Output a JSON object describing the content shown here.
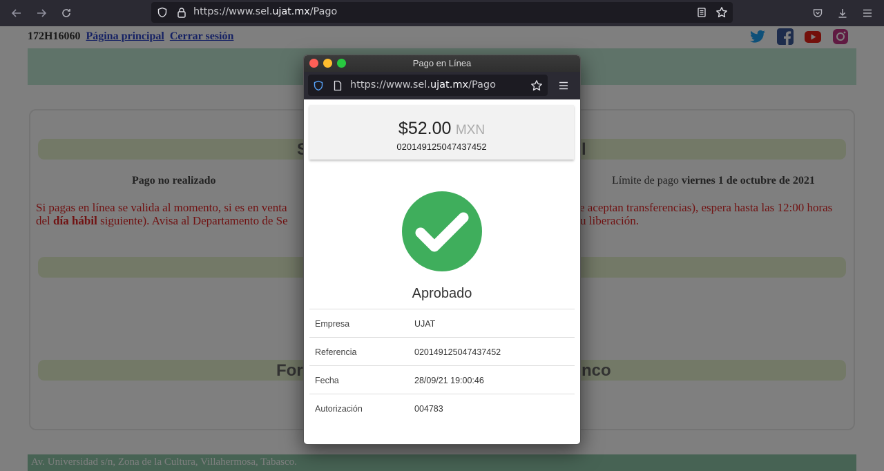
{
  "browser": {
    "url_prefix": "https://www.sel.",
    "url_domain": "ujat.mx",
    "url_path": "/Pago"
  },
  "page": {
    "user_id": "172H16060",
    "home_link": "Página principal",
    "logout_link": "Cerrar sesión",
    "status_left": "Pago no realizado",
    "limit_label": "Límite de pago",
    "limit_date": "viernes 1 de octubre de 2021",
    "warning_line1_a": "Si pagas en línea se valida al momento, si es en venta",
    "warning_line1_b": "e aceptan transferencias), espera hasta las 12:00 horas",
    "warning_line2_a": "del ",
    "warning_line2_bold": "día hábil",
    "warning_line2_b": " siguiente). Avisa al Departamento de Se",
    "warning_line2_c": "u liberación.",
    "section1_left": "S",
    "section1_right": "l",
    "section3_left": "For",
    "section3_right": "nco",
    "footer_address": "Av. Universidad s/n, Zona de la Cultura, Villahermosa, Tabasco."
  },
  "popup": {
    "window_title": "Pago en Línea",
    "url_prefix": "https://www.sel.",
    "url_domain": "ujat.mx",
    "url_path": "/Pago",
    "amount": "$52.00",
    "currency": "MXN",
    "amount_reference": "020149125047437452",
    "status": "Aprobado",
    "details": [
      {
        "label": "Empresa",
        "value": "UJAT"
      },
      {
        "label": "Referencia",
        "value": "020149125047437452"
      },
      {
        "label": "Fecha",
        "value": "28/09/21 19:00:46"
      },
      {
        "label": "Autorización",
        "value": "004783"
      }
    ]
  },
  "colors": {
    "success": "#3fae5c",
    "warning_text": "#e02424",
    "header_band": "#bfe6d2",
    "pill": "#e7f2cf"
  }
}
